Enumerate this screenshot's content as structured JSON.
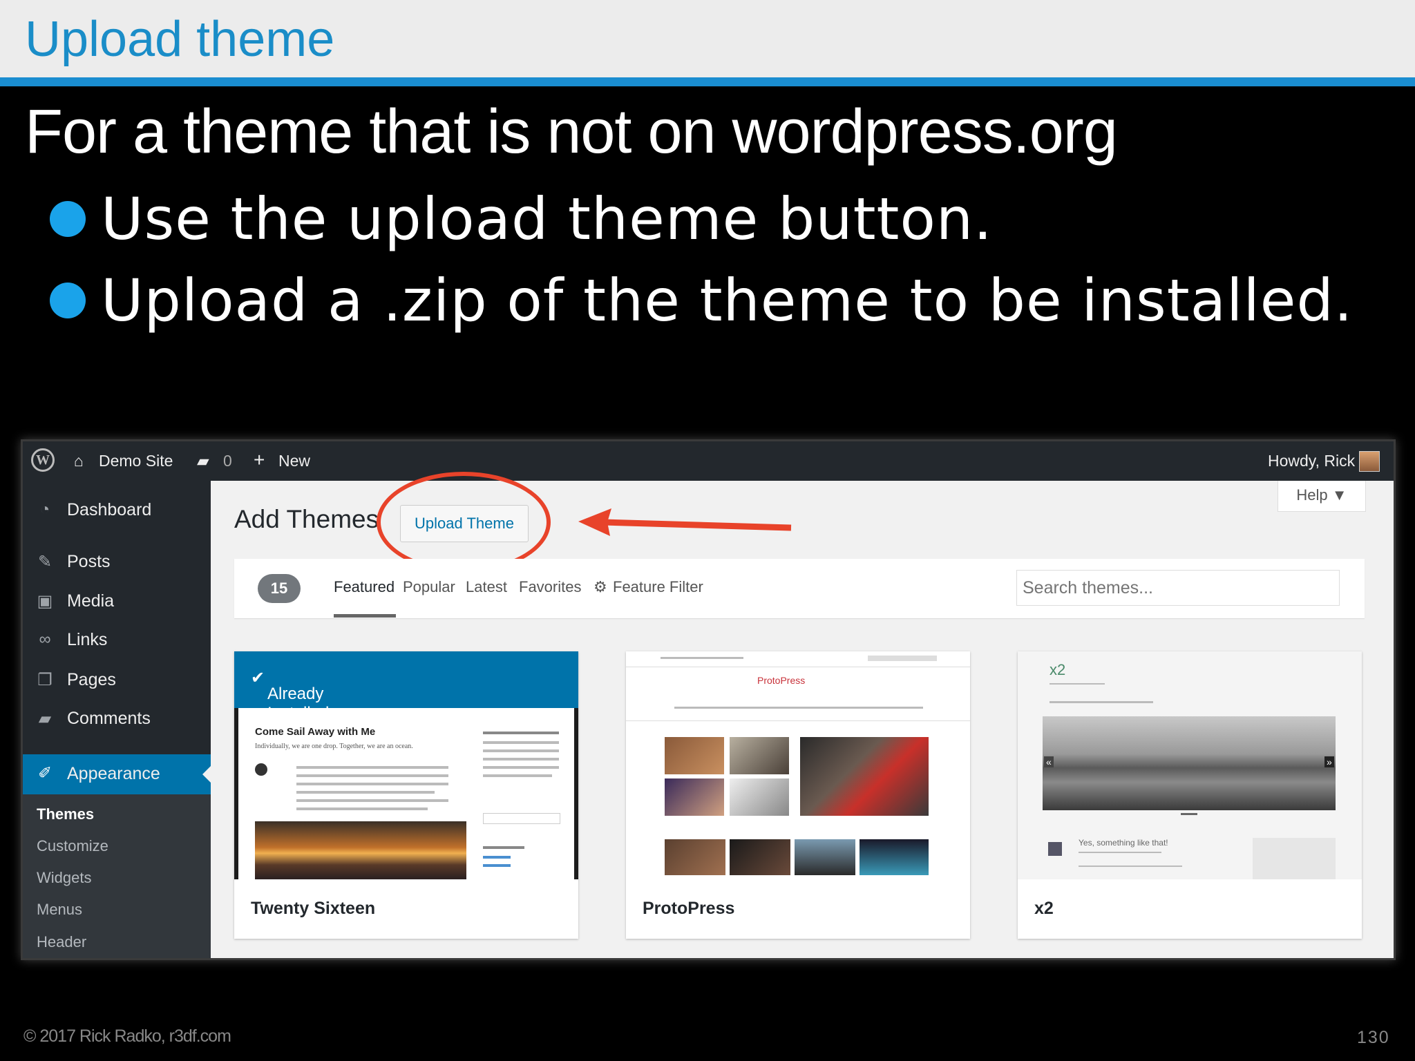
{
  "slide": {
    "title": "Upload theme",
    "heading": "For a theme that is not on wordpress.org",
    "bullets": [
      "Use the upload theme button.",
      "Upload a .zip of the theme to be installed."
    ],
    "footer": "© 2017 Rick Radko, r3df.com",
    "page_number": "130"
  },
  "adminbar": {
    "site": "Demo Site",
    "comments_count": "0",
    "new_label": "New",
    "howdy": "Howdy, Rick"
  },
  "sidebar": {
    "items": [
      {
        "label": "Dashboard",
        "icon": "dashboard-icon"
      },
      {
        "label": "Posts",
        "icon": "pin-icon"
      },
      {
        "label": "Media",
        "icon": "media-icon"
      },
      {
        "label": "Links",
        "icon": "link-icon"
      },
      {
        "label": "Pages",
        "icon": "pages-icon"
      },
      {
        "label": "Comments",
        "icon": "comment-icon"
      },
      {
        "label": "Appearance",
        "icon": "brush-icon"
      }
    ],
    "submenu": [
      "Themes",
      "Customize",
      "Widgets",
      "Menus",
      "Header"
    ]
  },
  "main": {
    "title": "Add Themes",
    "upload_button": "Upload Theme",
    "help": "Help",
    "count": "15",
    "tabs": [
      "Featured",
      "Popular",
      "Latest",
      "Favorites",
      "Feature Filter"
    ],
    "search_placeholder": "Search themes...",
    "themes": [
      {
        "name": "Twenty Sixteen",
        "badge": "Already Installed",
        "preview_heading": "Come Sail Away with Me",
        "preview_sub": "Individually, we are one drop. Together, we are an ocean."
      },
      {
        "name": "ProtoPress",
        "preview_logo": "ProtoPress"
      },
      {
        "name": "x2",
        "preview_logo": "x2",
        "preview_caption": "Yes, something like that!"
      }
    ]
  },
  "colors": {
    "accent": "#1a8dd0",
    "wp_blue": "#0073aa",
    "annotation_red": "#e8432a",
    "admin_dark": "#23282d"
  }
}
